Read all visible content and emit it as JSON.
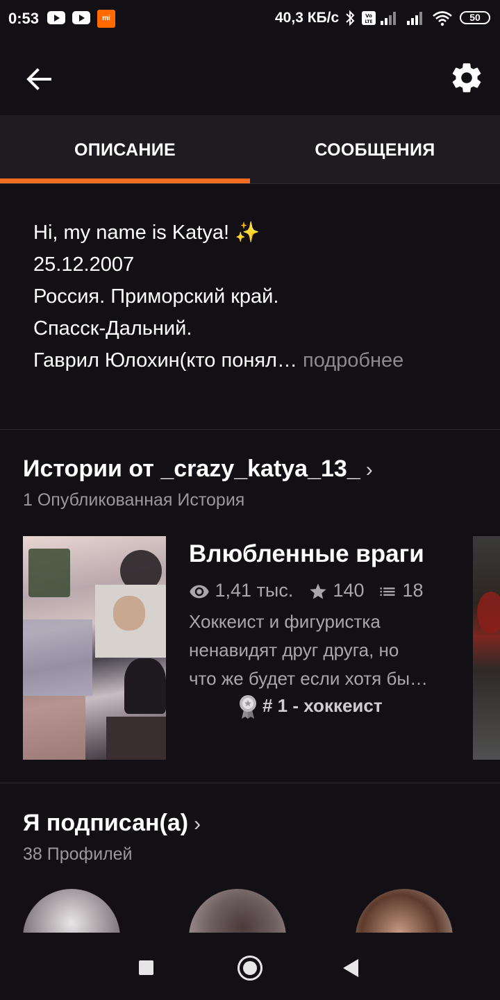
{
  "status_bar": {
    "time": "0:53",
    "speed": "40,3 КБ/с",
    "battery": "50",
    "icons": [
      "youtube-icon",
      "youtube-icon",
      "mi-app-icon",
      "bluetooth-icon",
      "volte-icon",
      "signal-icon",
      "signal-icon",
      "wifi-icon",
      "battery-icon"
    ]
  },
  "header": {
    "back_icon": "arrow-left-icon",
    "settings_icon": "gear-icon"
  },
  "tabs": [
    {
      "label": "ОПИСАНИЕ",
      "active": true
    },
    {
      "label": "СООБЩЕНИЯ",
      "active": false
    }
  ],
  "description": {
    "lines": [
      "Hi, my name is Katya! ✨",
      "25.12.2007",
      "Россия. Приморский край.",
      "Спасск-Дальний.",
      "Гаврил Юлохин(кто понял…"
    ],
    "more_label": "подробнее"
  },
  "stories_section": {
    "title": "Истории от _crazy_katya_13_",
    "subtitle": "1 Опубликованная История",
    "story": {
      "title": "Влюбленные враги",
      "reads": "1,41 тыс.",
      "votes": "140",
      "parts": "18",
      "description_lines": [
        "Хоккеист и фигуристка",
        "ненавидят друг друга, но",
        "что же будет если хотя бы…"
      ],
      "tag": "# 1 - хоккеист"
    }
  },
  "following_section": {
    "title": "Я подписан(а)",
    "subtitle": "38 Профилей"
  },
  "colors": {
    "background": "#121014",
    "tab_bar": "#1e1c20",
    "accent": "#f26d21",
    "muted_text": "#a9a7ab"
  }
}
